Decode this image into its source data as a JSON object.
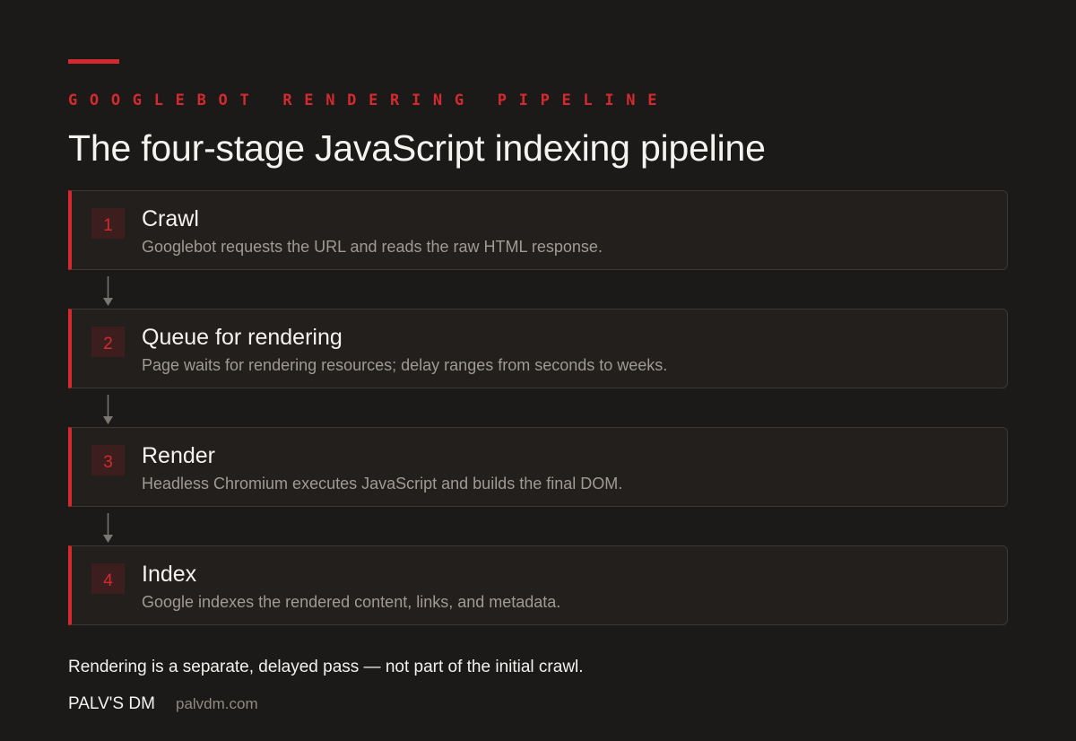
{
  "eyebrow": "GOOGLEBOT RENDERING PIPELINE",
  "title": "The four-stage JavaScript indexing pipeline",
  "stages": [
    {
      "number": "1",
      "title": "Crawl",
      "description": "Googlebot requests the URL and reads the raw HTML response."
    },
    {
      "number": "2",
      "title": "Queue for rendering",
      "description": "Page waits for rendering resources; delay ranges from seconds to weeks."
    },
    {
      "number": "3",
      "title": "Render",
      "description": "Headless Chromium executes JavaScript and builds the final DOM."
    },
    {
      "number": "4",
      "title": "Index",
      "description": "Google indexes the rendered content, links, and metadata."
    }
  ],
  "footnote": "Rendering is a separate, delayed pass — not part of the initial crawl.",
  "footer": {
    "brand": "PALV'S DM",
    "site": "palvdm.com"
  },
  "colors": {
    "background": "#1b1a19",
    "accent": "#d42a2f",
    "card": "#221f1d",
    "muted_text": "#9f9a94"
  }
}
